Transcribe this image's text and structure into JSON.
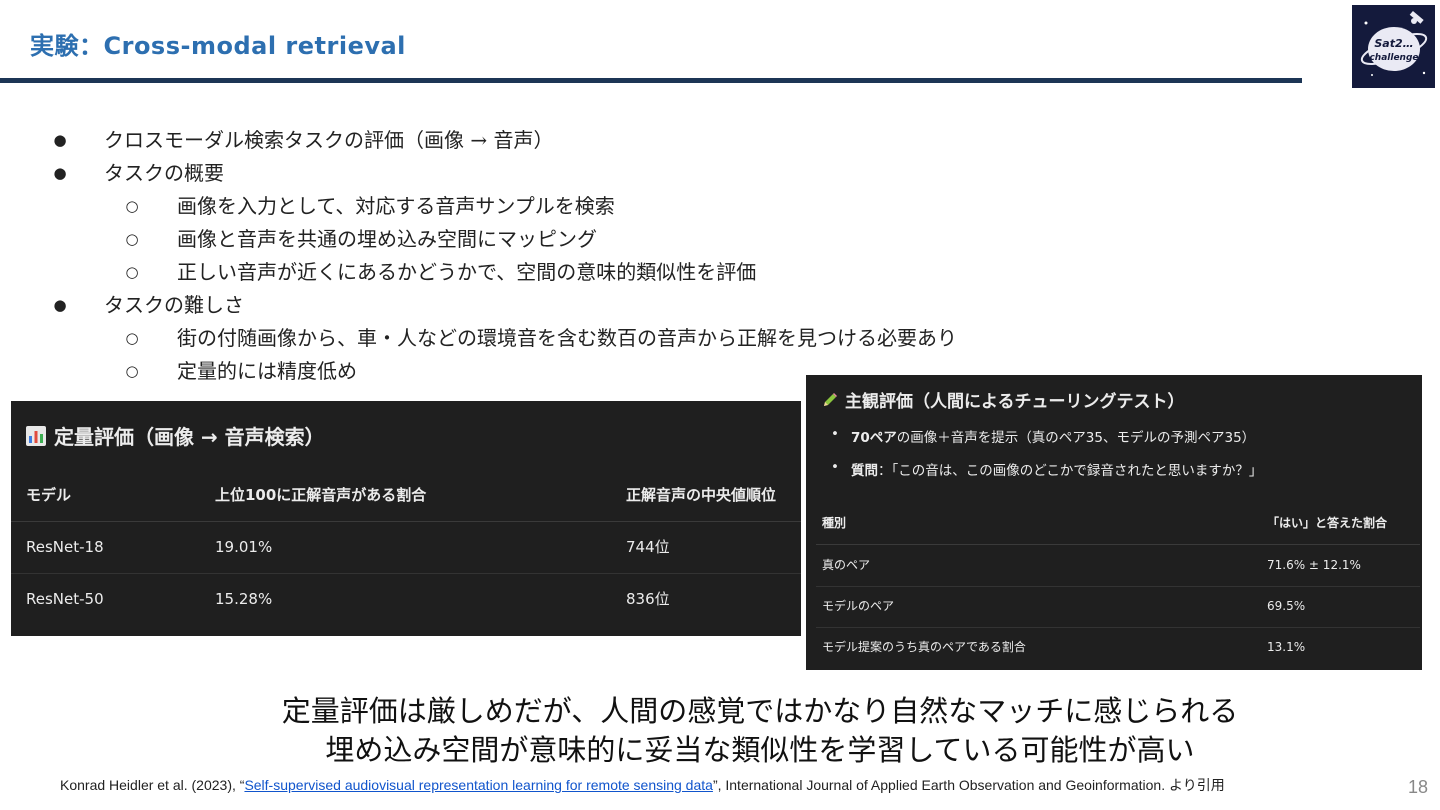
{
  "slide": {
    "title": "実験：Cross-modal retrieval",
    "page_number": "18",
    "logo_text": "Sat2… challenge",
    "bullets": [
      {
        "level": 1,
        "marker": "●",
        "text": "クロスモーダル検索タスクの評価（画像 → 音声）"
      },
      {
        "level": 1,
        "marker": "●",
        "text": "タスクの概要"
      },
      {
        "level": 2,
        "marker": "○",
        "text": "画像を入力として、対応する音声サンプルを検索"
      },
      {
        "level": 2,
        "marker": "○",
        "text": "画像と音声を共通の埋め込み空間にマッピング"
      },
      {
        "level": 2,
        "marker": "○",
        "text": "正しい音声が近くにあるかどうかで、空間の意味的類似性を評価"
      },
      {
        "level": 1,
        "marker": "●",
        "text": "タスクの難しさ"
      },
      {
        "level": 2,
        "marker": "○",
        "text": "街の付随画像から、車・人などの環境音を含む数百の音声から正解を見つける必要あり"
      },
      {
        "level": 2,
        "marker": "○",
        "text": "定量的には精度低め"
      }
    ],
    "quant_panel": {
      "icon": "bar-chart-icon",
      "title": "定量評価（画像 → 音声検索）",
      "headers": [
        "モデル",
        "上位100に正解音声がある割合",
        "正解音声の中央値順位"
      ],
      "rows": [
        [
          "ResNet-18",
          "19.01%",
          "744位"
        ],
        [
          "ResNet-50",
          "15.28%",
          "836位"
        ]
      ]
    },
    "subj_panel": {
      "icon": "pencil-icon",
      "title": "主観評価（人間によるチューリングテスト）",
      "points": [
        {
          "bold": "70ペア",
          "text": "の画像＋音声を提示（真のペア35、モデルの予測ペア35）"
        },
        {
          "bold": "質問",
          "text": "：「この音は、この画像のどこかで録音されたと思いますか？」"
        }
      ],
      "headers": [
        "種別",
        "「はい」と答えた割合"
      ],
      "rows": [
        [
          "真のペア",
          "71.6% ± 12.1%"
        ],
        [
          "モデルのペア",
          "69.5%"
        ],
        [
          "モデル提案のうち真のペアである割合",
          "13.1%"
        ]
      ]
    },
    "conclusion": [
      "定量評価は厳しめだが、人間の感覚ではかなり自然なマッチに感じられる",
      "埋め込み空間が意味的に妥当な類似性を学習している可能性が高い"
    ],
    "citation": {
      "prefix": "Konrad Heidler et al. (2023), “",
      "link": "Self-supervised audiovisual representation learning for remote sensing data",
      "suffix": "”, International Journal of Applied Earth Observation and Geoinformation. より引用"
    },
    "colors": {
      "title": "#2d6fb0",
      "rule": "#1c3555",
      "panel_bg": "#1f1f1f",
      "link": "#1155cc"
    }
  }
}
